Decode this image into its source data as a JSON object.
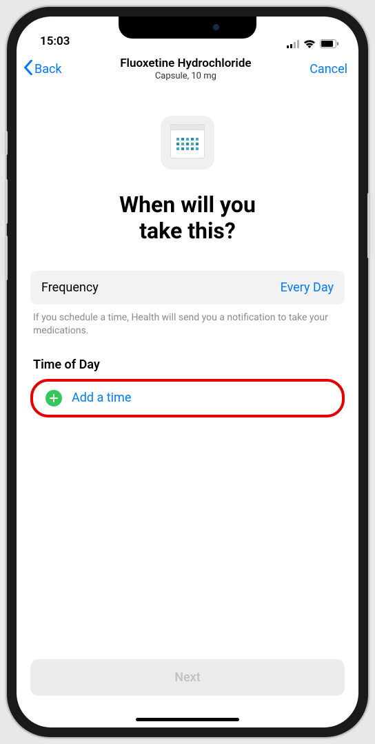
{
  "status": {
    "time": "15:03"
  },
  "nav": {
    "back_label": "Back",
    "title": "Fluoxetine Hydrochloride",
    "subtitle": "Capsule, 10 mg",
    "cancel_label": "Cancel"
  },
  "heading_line1": "When will you",
  "heading_line2": "take this?",
  "frequency": {
    "label": "Frequency",
    "value": "Every Day"
  },
  "helper_text": "If you schedule a time, Health will send you a notification to take your medications.",
  "time_section_header": "Time of Day",
  "add_time_label": "Add a time",
  "next_label": "Next"
}
